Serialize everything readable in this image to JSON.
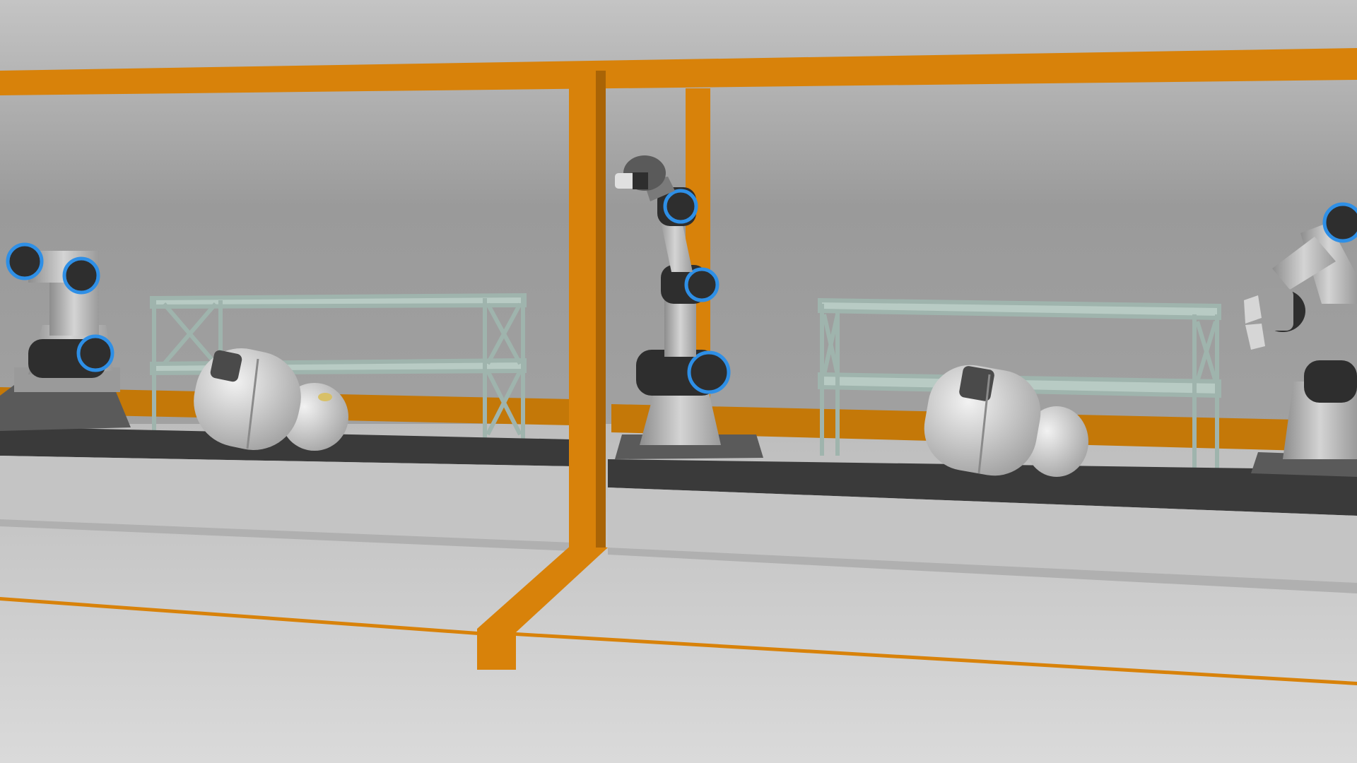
{
  "scene": {
    "colors": {
      "wall": "#9c9c9c",
      "floor": "#cfcfcf",
      "frame_orange": "#d8820a",
      "conveyor_belt": "#3a3a3a",
      "conveyor_side": "#c4c4c4",
      "shelf_frame": "#9fb4ad",
      "robot_body": "#bdbdbd",
      "robot_joint": "#2e2e2e",
      "robot_ring": "#2e8fe6",
      "product_shell": "#e2e2e2"
    },
    "objects": {
      "robot_arms": 3,
      "shelving_units": 2,
      "products_on_conveyor": 2
    }
  }
}
